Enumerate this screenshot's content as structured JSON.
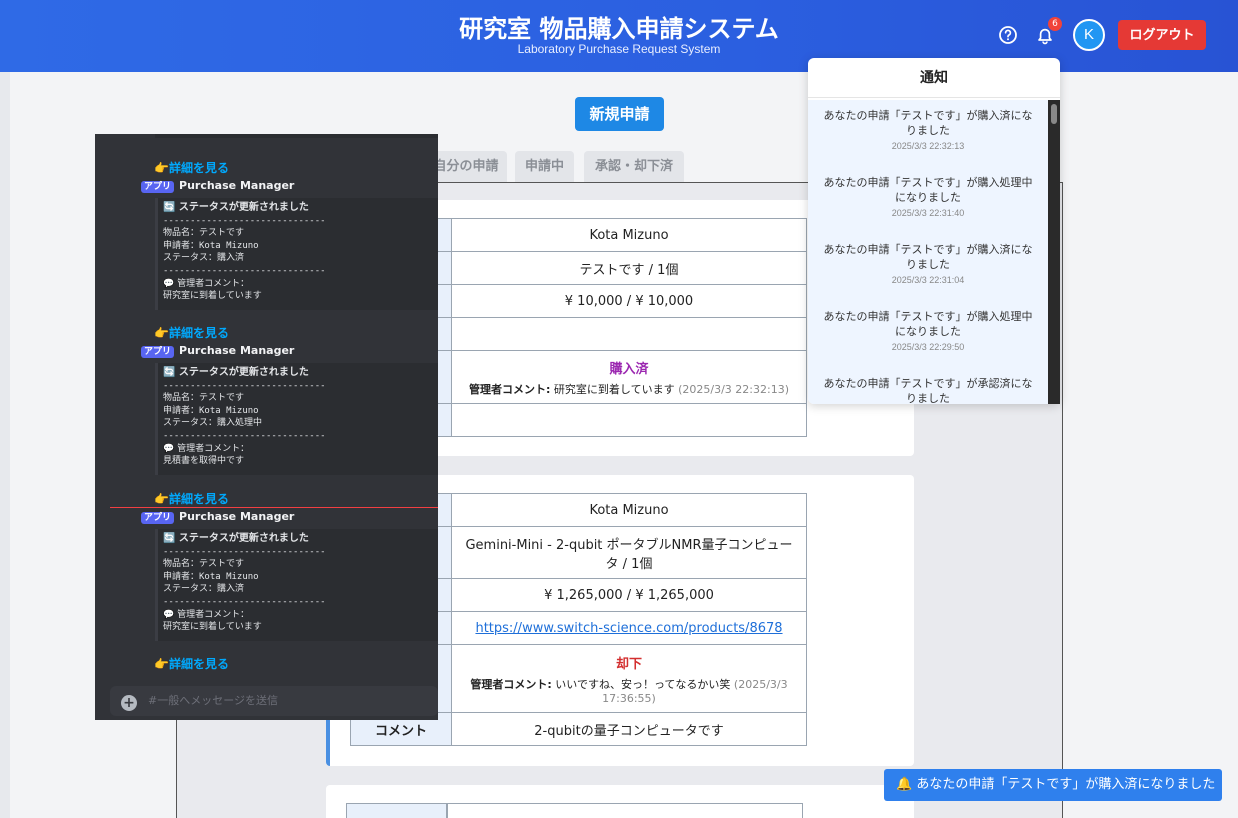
{
  "header": {
    "title": "研究室 物品購入申請システム",
    "subtitle": "Laboratory Purchase Request System",
    "notif_count": "6",
    "avatar_initial": "K",
    "logout_label": "ログアウト"
  },
  "main": {
    "new_request_label": "新規申請",
    "tabs": [
      "自分の申請",
      "申請中",
      "承認・却下済"
    ]
  },
  "cards": [
    {
      "rows": [
        {
          "label": "",
          "value": "Kota Mizuno"
        },
        {
          "label": "",
          "value": "テストです / 1個"
        },
        {
          "label": "",
          "value": "¥ 10,000 / ¥ 10,000"
        },
        {
          "label": "",
          "value": ""
        },
        {
          "label": "",
          "status": "購入済",
          "comment_label": "管理者コメント:",
          "comment": "研究室に到着しています",
          "comment_time": "(2025/3/3 22:32:13)"
        },
        {
          "label": "",
          "value": ""
        }
      ]
    },
    {
      "rows": [
        {
          "label": "",
          "value": "Kota Mizuno"
        },
        {
          "label": "",
          "value": "Gemini-Mini - 2-qubit ポータブルNMR量子コンピュータ / 1個"
        },
        {
          "label": "",
          "value": "¥ 1,265,000 / ¥ 1,265,000"
        },
        {
          "label": "",
          "value": "https://www.switch-science.com/products/8678"
        },
        {
          "label": "",
          "status": "却下",
          "comment_label": "管理者コメント:",
          "comment": "いいですね、安っ！ってなるかい笑",
          "comment_time": "(2025/3/3 17:36:55)"
        },
        {
          "label": "コメント",
          "value": "2-qubitの量子コンピュータです"
        }
      ]
    }
  ],
  "notifications": {
    "title": "通知",
    "items": [
      {
        "msg": "あなたの申請「テストです」が購入済になりました",
        "time": "2025/3/3 22:32:13"
      },
      {
        "msg": "あなたの申請「テストです」が購入処理中になりました",
        "time": "2025/3/3 22:31:40"
      },
      {
        "msg": "あなたの申請「テストです」が購入済になりました",
        "time": "2025/3/3 22:31:04"
      },
      {
        "msg": "あなたの申請「テストです」が購入処理中になりました",
        "time": "2025/3/3 22:29:50"
      },
      {
        "msg": "あなたの申請「テストです」が承認済になりました",
        "time": ""
      }
    ]
  },
  "toast": {
    "icon": "bell-icon",
    "text": "あなたの申請「テストです」が購入済になりました"
  },
  "discord": {
    "link_label": "👉詳細を見る",
    "app_tag": "アプリ",
    "app_name": "Purchase Manager",
    "embeds": [
      {
        "title": "🔄 ステータスが更新されました",
        "sep": "------------------------------",
        "item": "物品名：テストです",
        "requester": "申請者：Kota Mizuno",
        "status": "ステータス：購入済",
        "comment_head": "💬 管理者コメント：",
        "comment": "研究室に到着しています"
      },
      {
        "title": "🔄 ステータスが更新されました",
        "sep": "------------------------------",
        "item": "物品名：テストです",
        "requester": "申請者：Kota Mizuno",
        "status": "ステータス：購入処理中",
        "comment_head": "💬 管理者コメント：",
        "comment": "見積書を取得中です"
      },
      {
        "title": "🔄 ステータスが更新されました",
        "sep": "------------------------------",
        "item": "物品名：テストです",
        "requester": "申請者：Kota Mizuno",
        "status": "ステータス：購入済",
        "comment_head": "💬 管理者コメント：",
        "comment": "研究室に到着しています"
      }
    ],
    "input_placeholder": "#一般へメッセージを送信"
  },
  "colors": {
    "header": "#2f6ae6",
    "accent": "#1e88e5",
    "logout": "#e53935",
    "purchased": "#9b27b0",
    "rejected": "#d32f2f"
  }
}
